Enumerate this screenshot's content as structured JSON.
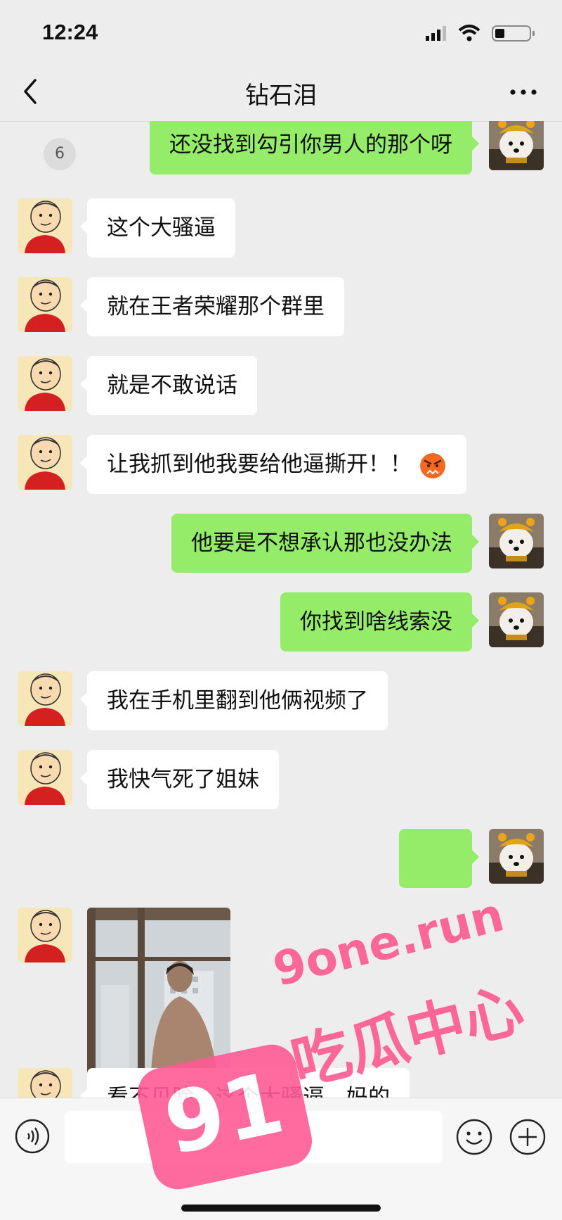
{
  "status_bar": {
    "time": "12:24"
  },
  "nav": {
    "back_badge": "6",
    "title": "钻石泪"
  },
  "messages": [
    {
      "side": "out",
      "text": "还没找到勾引你男人的那个呀"
    },
    {
      "side": "in",
      "text": "这个大骚逼"
    },
    {
      "side": "in",
      "text": "就在王者荣耀那个群里"
    },
    {
      "side": "in",
      "text": "就是不敢说话"
    },
    {
      "side": "in",
      "text": "让我抓到他我要给他逼撕开！！"
    },
    {
      "side": "out",
      "text": "他要是不想承认那也没办法"
    },
    {
      "side": "out",
      "text": "你找到啥线索没"
    },
    {
      "side": "in",
      "text": "我在手机里翻到他俩视频了"
    },
    {
      "side": "in",
      "text": "我快气死了姐妹"
    },
    {
      "side": "out",
      "text": ""
    },
    {
      "side": "in",
      "type": "video"
    },
    {
      "side": "in",
      "text": "看不见脸，这个大骚逼，妈的"
    }
  ],
  "watermark": {
    "url": "9one.run",
    "brand": "吃瓜中心",
    "number": "91"
  },
  "colors": {
    "out_bubble": "#95ec69",
    "in_bubble": "#ffffff",
    "background": "#ededed",
    "watermark": "#ff4f8b"
  },
  "icons": [
    "signal-icon",
    "wifi-icon",
    "battery-icon",
    "back-chevron-icon",
    "more-icon",
    "voice-icon",
    "emoji-icon",
    "plus-icon",
    "angry-emoji-icon"
  ]
}
